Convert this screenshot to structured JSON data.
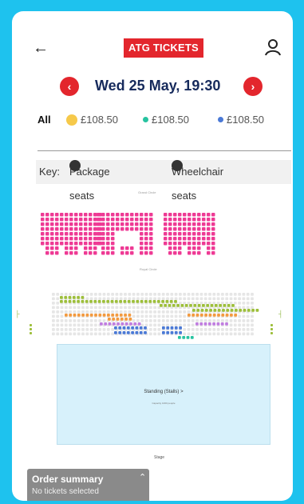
{
  "header": {
    "back_icon": "arrow-left-icon",
    "logo_text": "ATG TICKETS",
    "user_icon": "user-icon",
    "brand_color": "#e3262d"
  },
  "performance": {
    "date": "Wed 25 May, 19:30",
    "prev_icon": "chevron-left-icon",
    "next_icon": "chevron-right-icon"
  },
  "prices": {
    "all_label": "All",
    "items": [
      {
        "label": "£108.50",
        "color": "#f6c94a"
      },
      {
        "label": "£108.50",
        "color": "#27c3a0"
      },
      {
        "label": "£108.50",
        "color": "#4a79d6"
      }
    ]
  },
  "key": {
    "label": "Key:",
    "package": "Package seats",
    "wheelchair": "Wheelchair seats"
  },
  "map": {
    "circle_label": "Grand Circle",
    "stalls_label": "Royal Circle",
    "standing_label": "Standing (Stalls) >",
    "standing_sub": "Capacity 1000 people",
    "stage_label": "Stage",
    "seat_colors": {
      "circle": "#ee3a94",
      "green": "#9dbf3a",
      "orange": "#f39a3f",
      "purple": "#c07de0",
      "blue": "#4a79d6",
      "teal": "#27c3a0"
    }
  },
  "order_summary": {
    "title": "Order summary",
    "subtitle": "No tickets selected",
    "toggle_icon": "chevron-up-icon"
  }
}
